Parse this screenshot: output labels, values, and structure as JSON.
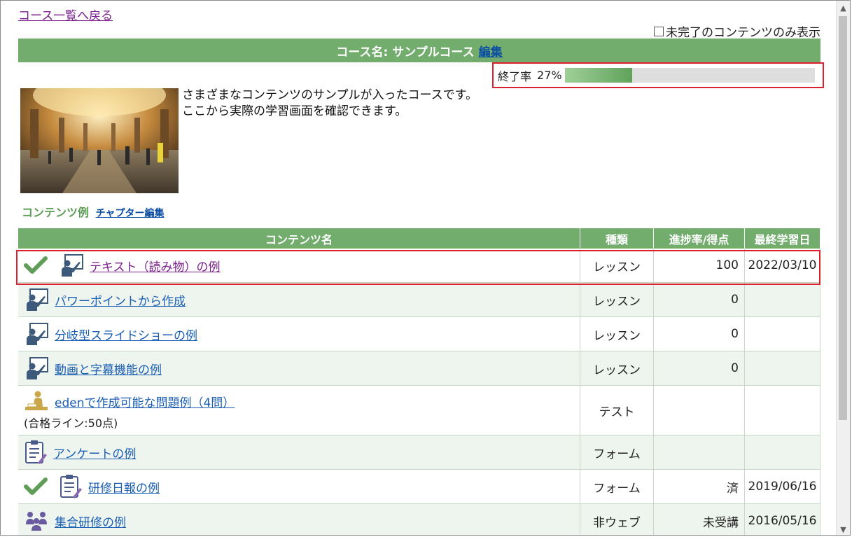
{
  "back_link": "コース一覧へ戻る",
  "filter_label": "未完了のコンテンツのみ表示",
  "course": {
    "title": "コース名: サンプルコース",
    "edit": "編集",
    "completion_label": "終了率",
    "completion_pct": "27%",
    "completion_value": 0.27,
    "description_line1": "さまざまなコンテンツのサンプルが入ったコースです。",
    "description_line2": "ここから実際の学習画面を確認できます。"
  },
  "section": {
    "title": "コンテンツ例",
    "edit": "チャプター編集"
  },
  "table": {
    "headers": [
      "コンテンツ名",
      "種類",
      "進捗率/得点",
      "最終学習日"
    ],
    "rows": [
      {
        "name": "テキスト（読み物）の例",
        "type": "レッスン",
        "progress": "100",
        "date": "2022/03/10",
        "icon": "lecture-icon",
        "done": true
      },
      {
        "name": "パワーポイントから作成",
        "type": "レッスン",
        "progress": "0",
        "date": "",
        "icon": "lecture-icon",
        "done": false
      },
      {
        "name": "分岐型スライドショーの例",
        "type": "レッスン",
        "progress": "0",
        "date": "",
        "icon": "lecture-icon",
        "done": false
      },
      {
        "name": "動画と字幕機能の例",
        "type": "レッスン",
        "progress": "0",
        "date": "",
        "icon": "lecture-icon",
        "done": false
      },
      {
        "name": "edenで作成可能な問題例（4問）",
        "sub": "(合格ライン:50点)",
        "type": "テスト",
        "progress": "",
        "date": "",
        "icon": "test-icon",
        "done": false
      },
      {
        "name": "アンケートの例",
        "type": "フォーム",
        "progress": "",
        "date": "",
        "icon": "clipboard-icon",
        "done": false
      },
      {
        "name": "研修日報の例",
        "type": "フォーム",
        "progress": "済",
        "date": "2019/06/16",
        "icon": "clipboard-icon",
        "done": true
      },
      {
        "name": "集合研修の例",
        "type": "非ウェブ",
        "progress": "未受講",
        "date": "2016/05/16",
        "icon": "group-icon",
        "done": false
      }
    ]
  },
  "colors": {
    "header_green": "#72ad6d",
    "highlight_red": "#d9222d",
    "link_blue": "#1a5fb4",
    "visited_purple": "#7a1f8c"
  }
}
